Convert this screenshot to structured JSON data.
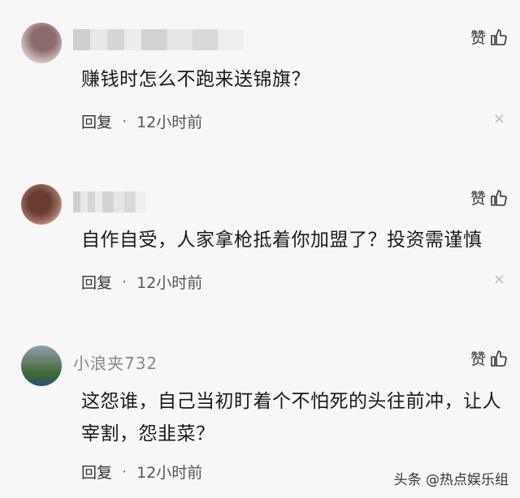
{
  "comments": [
    {
      "username": "",
      "like_label": "赞",
      "text": "赚钱时怎么不跑来送锦旗？",
      "reply_label": "回复",
      "separator": "·",
      "time": "12小时前"
    },
    {
      "username": "",
      "like_label": "赞",
      "text": "自作自受，人家拿枪抵着你加盟了？投资需谨慎",
      "reply_label": "回复",
      "separator": "·",
      "time": "12小时前"
    },
    {
      "username": "小浪夹732",
      "like_label": "赞",
      "text": "这怨谁，自己当初盯着个不怕死的头往前冲，让人宰割，怨韭菜？",
      "reply_label": "回复",
      "separator": "·",
      "time": "12小时前"
    }
  ],
  "close_icon_glyph": "×",
  "watermark": "头条 @热点娱乐组"
}
